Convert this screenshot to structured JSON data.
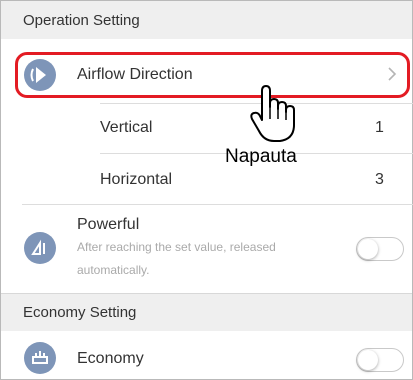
{
  "colors": {
    "accent": "#e31b23",
    "icon_fill": "#7e95b8",
    "section_bg": "#efefef"
  },
  "operation_setting": {
    "header": "Operation Setting",
    "airflow": {
      "label": "Airflow Direction",
      "icon": "airflow-icon",
      "chevron": "chevron-right-icon"
    },
    "vertical": {
      "label": "Vertical",
      "value": "1"
    },
    "horizontal": {
      "label": "Horizontal",
      "value": "3"
    },
    "powerful": {
      "label": "Powerful",
      "description_line1": "After reaching the set value, released",
      "description_line2": "automatically.",
      "icon": "powerful-icon",
      "toggle_on": false
    }
  },
  "economy_setting": {
    "header": "Economy Setting",
    "economy": {
      "label": "Economy",
      "icon": "economy-icon",
      "toggle_on": false
    }
  },
  "annotation": {
    "callout": "Napauta",
    "cursor": "hand-pointer-icon"
  }
}
